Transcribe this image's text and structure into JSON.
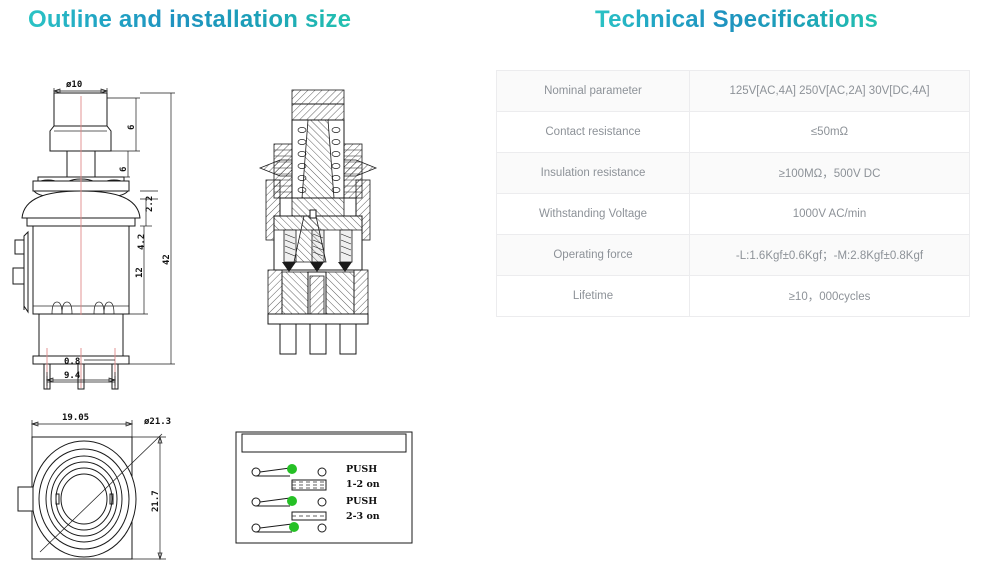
{
  "titles": {
    "left": "Outline and installation size",
    "right": "Technical Specifications"
  },
  "spec_table": {
    "rows": [
      {
        "key": "Nominal parameter",
        "value": "125V[AC,4A] 250V[AC,2A] 30V[DC,4A]"
      },
      {
        "key": "Contact resistance",
        "value": "≤50mΩ"
      },
      {
        "key": "Insulation resistance",
        "value": "≥100MΩ，500V DC"
      },
      {
        "key": "Withstanding Voltage",
        "value": "1000V AC/min"
      },
      {
        "key": "Operating force",
        "value": "-L:1.6Kgf±0.6Kgf；-M:2.8Kgf±0.8Kgf"
      },
      {
        "key": "Lifetime",
        "value": "≥10，000cycles"
      }
    ]
  },
  "drawings": {
    "side_view": {
      "name": "side-elevation-view",
      "dimensions": {
        "top_diameter": "ø10",
        "cap_height": "6",
        "stem_height": "6",
        "flange_thin": "2.2",
        "flange_thick": "4.2",
        "body_height": "12",
        "overall_height": "42",
        "pin_width": "0.8",
        "pin_span": "9.4"
      }
    },
    "section_view": {
      "name": "cross-section-view"
    },
    "bottom_view": {
      "name": "bottom-plan-view",
      "dimensions": {
        "width": "19.05",
        "bezel_diameter": "ø21.3",
        "height": "21.7"
      }
    },
    "schematic": {
      "name": "contact-schematic",
      "labels": [
        "PUSH",
        "1-2 on",
        "PUSH",
        "2-3 on"
      ],
      "contact_color": "#25c025"
    }
  },
  "colors": {
    "title_gradient_start": "#2bc4c4",
    "title_gradient_mid": "#1f93c0",
    "title_gradient_end": "#23c2b0",
    "table_border": "#ececee",
    "table_text": "#8d9298",
    "table_alt_row": "#fafafa",
    "centerline": "#e08a8a",
    "line": "#1a1a1a"
  }
}
